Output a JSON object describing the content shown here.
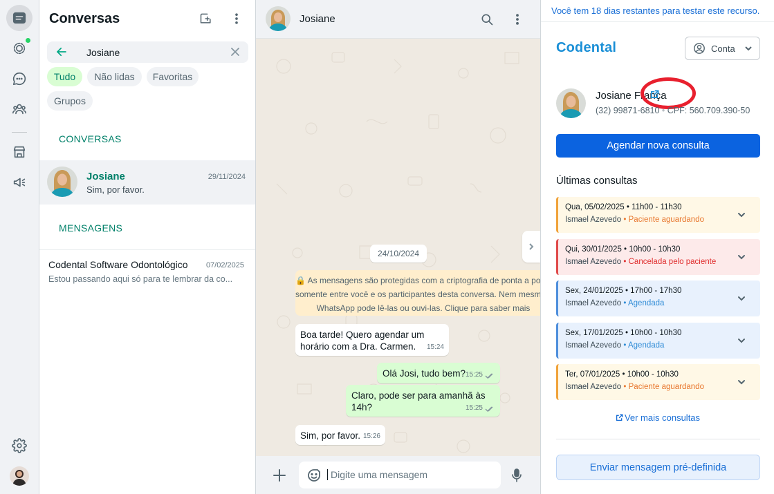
{
  "rail": {
    "icons": [
      "chats-icon",
      "status-icon",
      "channels-icon",
      "communities-icon",
      "store-icon",
      "broadcast-icon",
      "settings-icon"
    ]
  },
  "list": {
    "title": "Conversas",
    "search_value": "Josiane",
    "filters": [
      "Tudo",
      "Não lidas",
      "Favoritas",
      "Grupos"
    ],
    "section_conversations": "CONVERSAS",
    "section_messages": "MENSAGENS",
    "conversation": {
      "name": "Josiane",
      "date": "29/11/2024",
      "preview": "Sim, por favor."
    },
    "message_result": {
      "name": "Codental Software Odontológico",
      "date": "07/02/2025",
      "preview": "Estou passando aqui só para te lembrar da co..."
    }
  },
  "chat": {
    "contact_name": "Josiane",
    "date_pill": "24/10/2024",
    "encryption_lines": [
      "🔒 As mensagens são protegidas com a criptografia de ponta a ponta",
      "somente entre você e os participantes desta conversa. Nem mesmo o",
      "WhatsApp pode lê-las ou ouvi-las. Clique para saber mais"
    ],
    "messages": [
      {
        "text": "Boa tarde! Quero agendar um\nhorário com a Dra. Carmen.",
        "time": "15:24"
      },
      {
        "text": "Olá Josi, tudo bem?",
        "time": "15:25"
      },
      {
        "text": "Claro, pode ser para amanhã às\n14h?",
        "time": "15:25"
      },
      {
        "text": "Sim, por favor.",
        "time": "15:26"
      }
    ],
    "composer_placeholder": "Digite uma mensagem"
  },
  "panel": {
    "trial_notice": "Você tem 18 dias restantes para testar este recurso.",
    "brand": "Codental",
    "account_label": "Conta",
    "patient": {
      "name": "Josiane França",
      "phone": "(32) 99871-6810",
      "cpf": "CPF: 560.709.390-50"
    },
    "schedule_button": "Agendar nova consulta",
    "latest_title": "Últimas consultas",
    "appointments": [
      {
        "when": "Qua, 05/02/2025 • 11h00 - 11h30",
        "doctor": "Ismael Azevedo",
        "status": "Paciente aguardando"
      },
      {
        "when": "Qui, 30/01/2025 • 10h00 - 10h30",
        "doctor": "Ismael Azevedo",
        "status": "Cancelada pelo paciente"
      },
      {
        "when": "Sex, 24/01/2025 • 17h00 - 17h30",
        "doctor": "Ismael Azevedo",
        "status": "Agendada"
      },
      {
        "when": "Sex, 17/01/2025 • 10h00 - 10h30",
        "doctor": "Ismael Azevedo",
        "status": "Agendada"
      },
      {
        "when": "Ter, 07/01/2025 • 10h00 - 10h30",
        "doctor": "Ismael Azevedo",
        "status": "Paciente aguardando"
      }
    ],
    "see_more": "Ver mais consultas",
    "predefined_button": "Enviar mensagem pré-definida"
  },
  "colors": {
    "whatsapp_green": "#00a884",
    "chat_background": "#efeae2",
    "outgoing_bubble": "#d9fdd3",
    "primary_blue": "#0b63e0",
    "brand_blue": "#1a8fd6",
    "highlight_ring": "#e8202e",
    "status_waiting": "#e8772e",
    "status_cancelled": "#e02e2e",
    "status_scheduled": "#2e8bd6"
  }
}
